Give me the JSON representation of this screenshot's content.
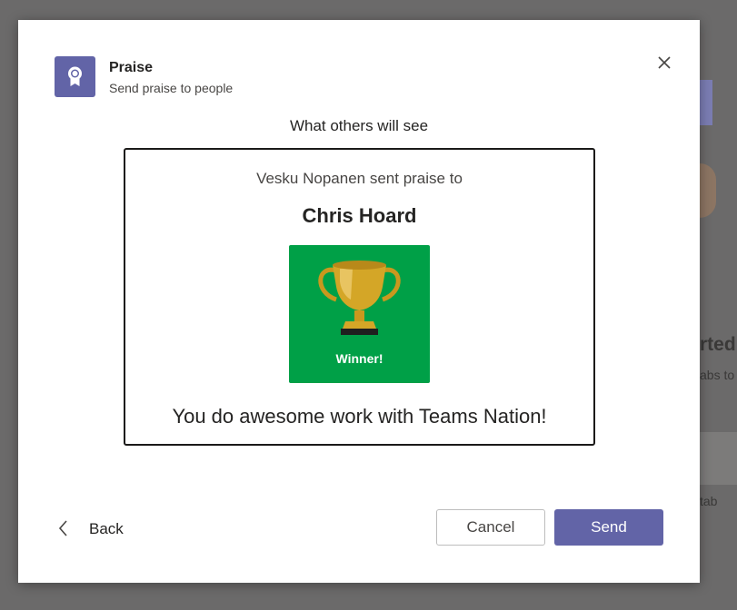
{
  "background": {
    "heading_fragment": "rted",
    "text_fragment": "abs to",
    "tab_fragment": "tab"
  },
  "dialog": {
    "app_name": "Praise",
    "app_subtitle": "Send praise to people",
    "preview_label": "What others will see",
    "card": {
      "sender_line": "Vesku Nopanen sent praise to",
      "recipient": "Chris Hoard",
      "badge_label": "Winner!",
      "message": "You do awesome work with Teams Nation!"
    },
    "footer": {
      "back_label": "Back",
      "cancel_label": "Cancel",
      "send_label": "Send"
    }
  },
  "colors": {
    "accent": "#6264a7",
    "badge_green": "#00a047",
    "trophy_gold": "#d4a627"
  },
  "icons": [
    "award-icon",
    "close-icon",
    "chevron-left-icon",
    "trophy-icon"
  ]
}
